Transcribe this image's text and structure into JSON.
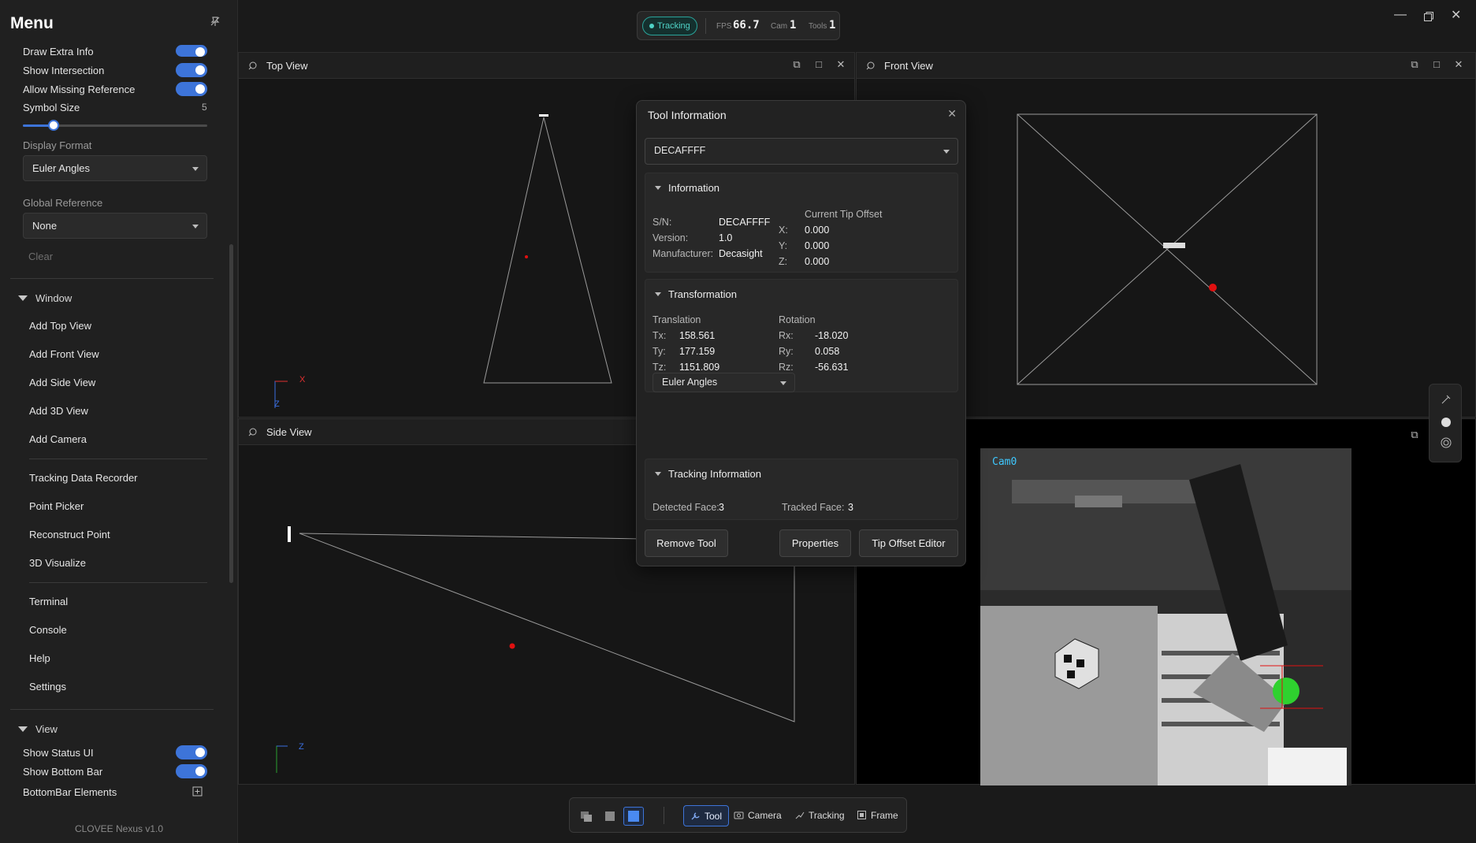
{
  "sidebar": {
    "title": "Menu",
    "top_toggles": [
      {
        "label": "Draw Extra Info"
      },
      {
        "label": "Show Intersection"
      },
      {
        "label": "Allow Missing Reference"
      }
    ],
    "symbol_size": {
      "label": "Symbol Size",
      "value": "5"
    },
    "display_format": {
      "label": "Display Format",
      "value": "Euler Angles"
    },
    "global_reference": {
      "label": "Global Reference",
      "value": "None"
    },
    "clear_label": "Clear",
    "window_section": "Window",
    "window_items": [
      "Add Top View",
      "Add Front View",
      "Add Side View",
      "Add 3D View",
      "Add Camera"
    ],
    "tool_items": [
      "Tracking Data Recorder",
      "Point Picker",
      "Reconstruct Point",
      "3D Visualize"
    ],
    "misc_items": [
      "Terminal",
      "Console",
      "Help",
      "Settings"
    ],
    "view_section": "View",
    "view_toggles": [
      {
        "label": "Show Status UI"
      },
      {
        "label": "Show Bottom Bar"
      }
    ],
    "bottombar_elements": "BottomBar Elements",
    "version": "CLOVEE Nexus v1.0"
  },
  "status": {
    "tracking": "Tracking",
    "fps_label": "FPS",
    "fps_value": "66.7",
    "cam_label": "Cam",
    "cam_value": "1",
    "tools_label": "Tools",
    "tools_value": "1"
  },
  "panels": {
    "top": "Top View",
    "front": "Front View",
    "side": "Side View",
    "camera_label": "Cam0"
  },
  "axes": {
    "top": {
      "h": "X",
      "v": "Z"
    },
    "side": {
      "h": "Z",
      "v": ""
    }
  },
  "dialog": {
    "title": "Tool Information",
    "tool_select": "DECAFFFF",
    "information": {
      "header": "Information",
      "sn_label": "S/N:",
      "sn": "DECAFFFF",
      "version_label": "Version:",
      "version": "1.0",
      "manufacturer_label": "Manufacturer:",
      "manufacturer": "Decasight",
      "tip_offset_title": "Current Tip Offset",
      "x_label": "X:",
      "x": "0.000",
      "y_label": "Y:",
      "y": "0.000",
      "z_label": "Z:",
      "z": "0.000"
    },
    "transformation": {
      "header": "Transformation",
      "translation_title": "Translation",
      "rotation_title": "Rotation",
      "tx_label": "Tx:",
      "tx": "158.561",
      "ty_label": "Ty:",
      "ty": "177.159",
      "tz_label": "Tz:",
      "tz": "1151.809",
      "rx_label": "Rx:",
      "rx": "-18.020",
      "ry_label": "Ry:",
      "ry": "0.058",
      "rz_label": "Rz:",
      "rz": "-56.631",
      "format": "Euler Angles"
    },
    "tracking": {
      "header": "Tracking Information",
      "detected_label": "Detected Face:",
      "detected": "3",
      "tracked_label": "Tracked Face:",
      "tracked": "3"
    },
    "buttons": {
      "remove": "Remove Tool",
      "properties": "Properties",
      "tip_offset": "Tip Offset Editor"
    }
  },
  "bottombar": {
    "tabs": [
      "Tool",
      "Camera",
      "Tracking",
      "Frame"
    ]
  },
  "colors": {
    "accent": "#3d74d9",
    "tracking": "#4fd1c5",
    "marker": "#e01010"
  }
}
